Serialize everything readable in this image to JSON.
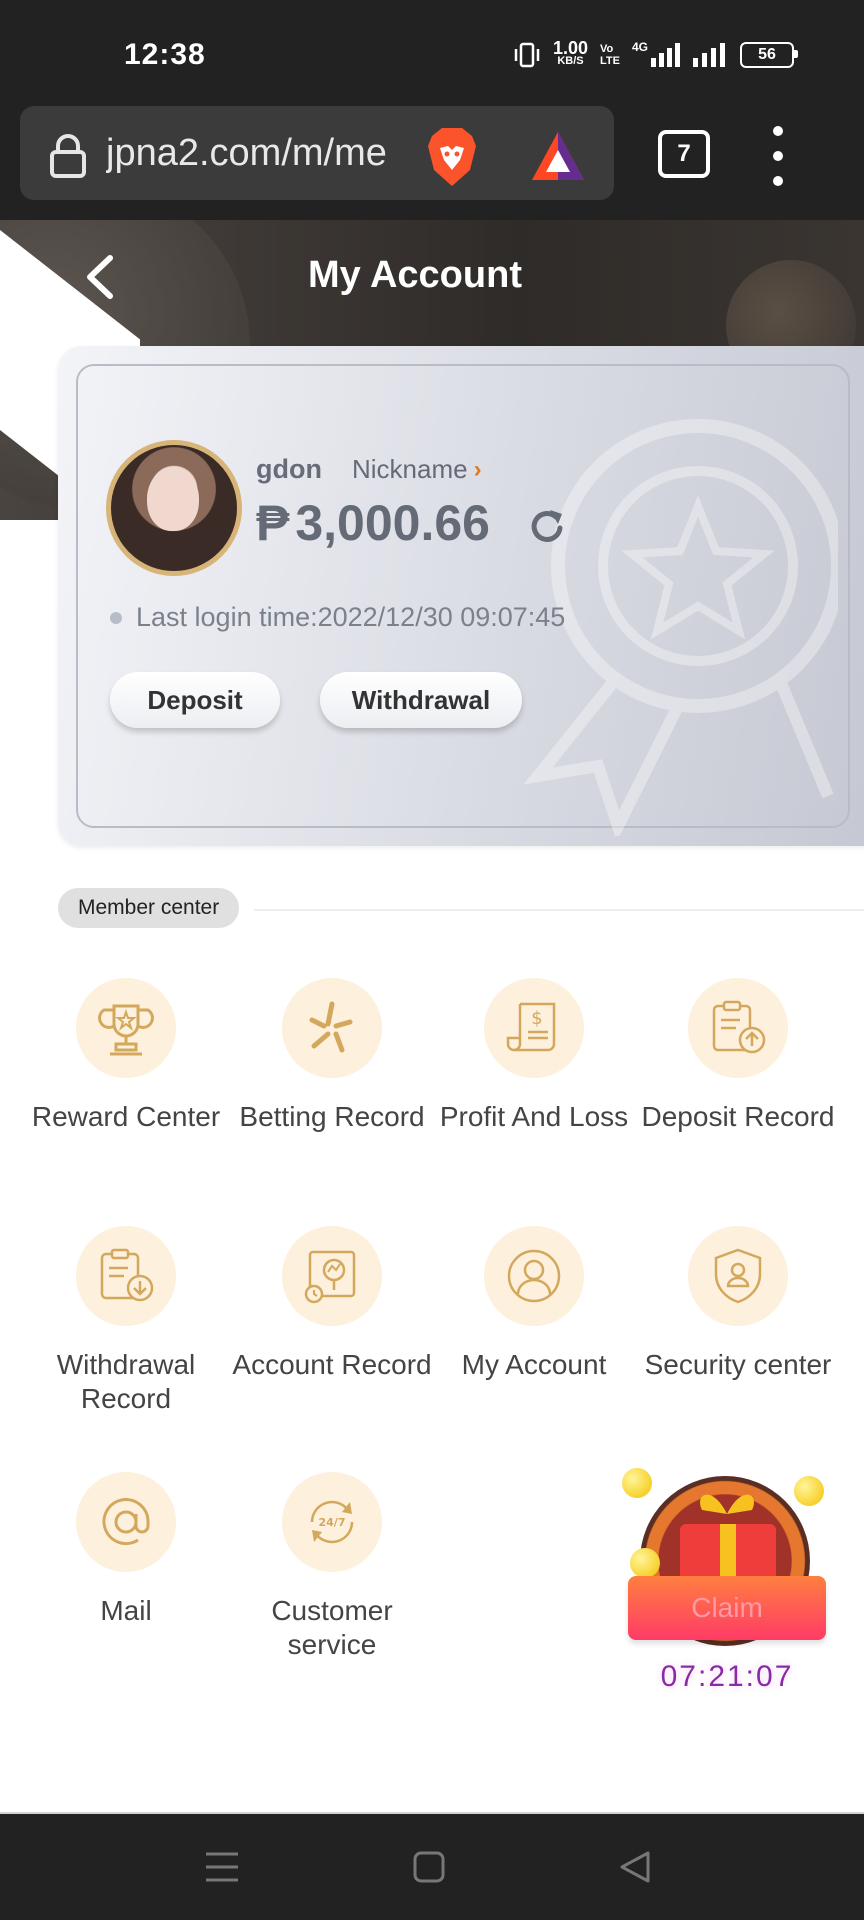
{
  "status_bar": {
    "time": "12:38",
    "net_speed_value": "1.00",
    "net_speed_unit": "KB/S",
    "volte_top": "Vo",
    "volte_bottom": "LTE",
    "network": "4G",
    "battery": "56"
  },
  "browser": {
    "url": "jpna2.com/m/me",
    "tab_count": "7"
  },
  "header": {
    "title": "My Account"
  },
  "account": {
    "username": "gdon",
    "nickname_label": "Nickname",
    "currency_symbol": "₱",
    "balance": "3,000.66",
    "last_login": "Last login time:2022/12/30 09:07:45",
    "deposit_label": "Deposit",
    "withdrawal_label": "Withdrawal"
  },
  "member_center": {
    "label": "Member center",
    "items": [
      {
        "label": "Reward Center",
        "icon": "trophy-icon"
      },
      {
        "label": "Betting Record",
        "icon": "sparkle-icon"
      },
      {
        "label": "Profit And Loss",
        "icon": "receipt-dollar-icon"
      },
      {
        "label": "Deposit Record",
        "icon": "clipboard-upload-icon"
      },
      {
        "label": "Withdrawal Record",
        "icon": "clipboard-download-icon"
      },
      {
        "label": "Account Record",
        "icon": "chart-search-icon"
      },
      {
        "label": "My Account",
        "icon": "user-icon"
      },
      {
        "label": "Security center",
        "icon": "shield-user-icon"
      },
      {
        "label": "Mail",
        "icon": "at-icon"
      },
      {
        "label": "Customer service",
        "icon": "support-247-icon"
      }
    ]
  },
  "claim": {
    "label": "Claim",
    "timer": "07:21:07"
  },
  "colors": {
    "accent_gold": "#d7b477",
    "icon_bg": "#fdf0dc",
    "claim_gradient_top": "#ff7f3f",
    "claim_gradient_bottom": "#ff3b66",
    "timer": "#8a2aa6"
  }
}
